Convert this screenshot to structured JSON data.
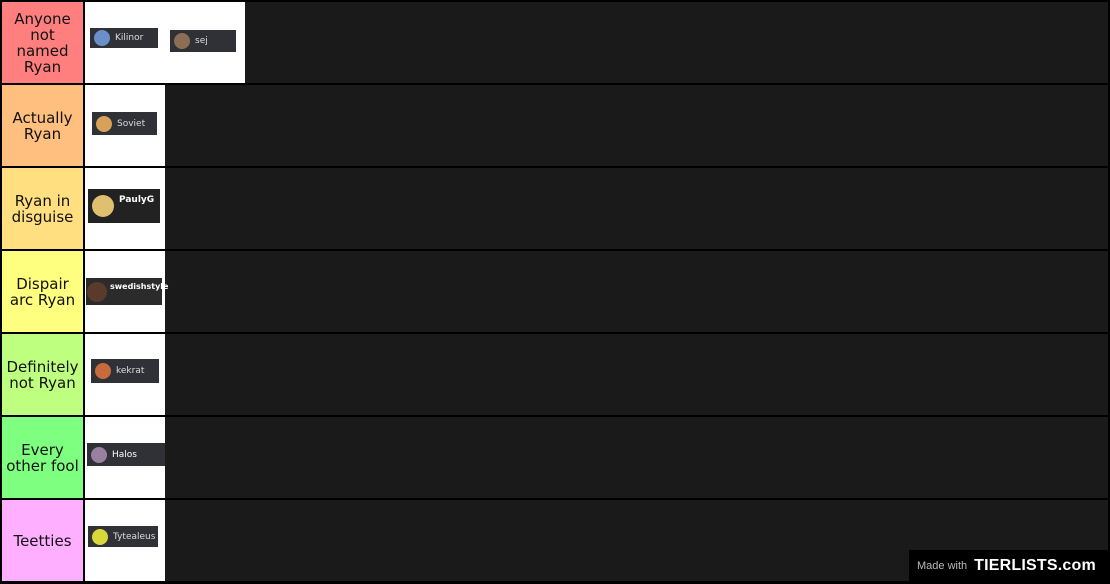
{
  "tiers": [
    {
      "label": "Anyone not named Ryan",
      "color": "#ff7f7f",
      "items": [
        "Kilinor",
        "sej"
      ]
    },
    {
      "label": "Actually Ryan",
      "color": "#ffbf7f",
      "items": [
        "Soviet"
      ]
    },
    {
      "label": "Ryan in disguise",
      "color": "#ffdf7f",
      "items": [
        "PaulyG"
      ]
    },
    {
      "label": "Dispair arc Ryan",
      "color": "#ffff7f",
      "items": [
        "swedishstyle"
      ]
    },
    {
      "label": "Definitely not Ryan",
      "color": "#bfff7f",
      "items": [
        "kekrat"
      ]
    },
    {
      "label": "Every other fool",
      "color": "#7fff7f",
      "items": [
        "Halos"
      ]
    },
    {
      "label": "Teetties",
      "color": "#ffafff",
      "items": [
        "Tytealeus"
      ]
    }
  ],
  "watermark": {
    "made_with": "Made with",
    "logo": "TIERLISTS.com"
  }
}
